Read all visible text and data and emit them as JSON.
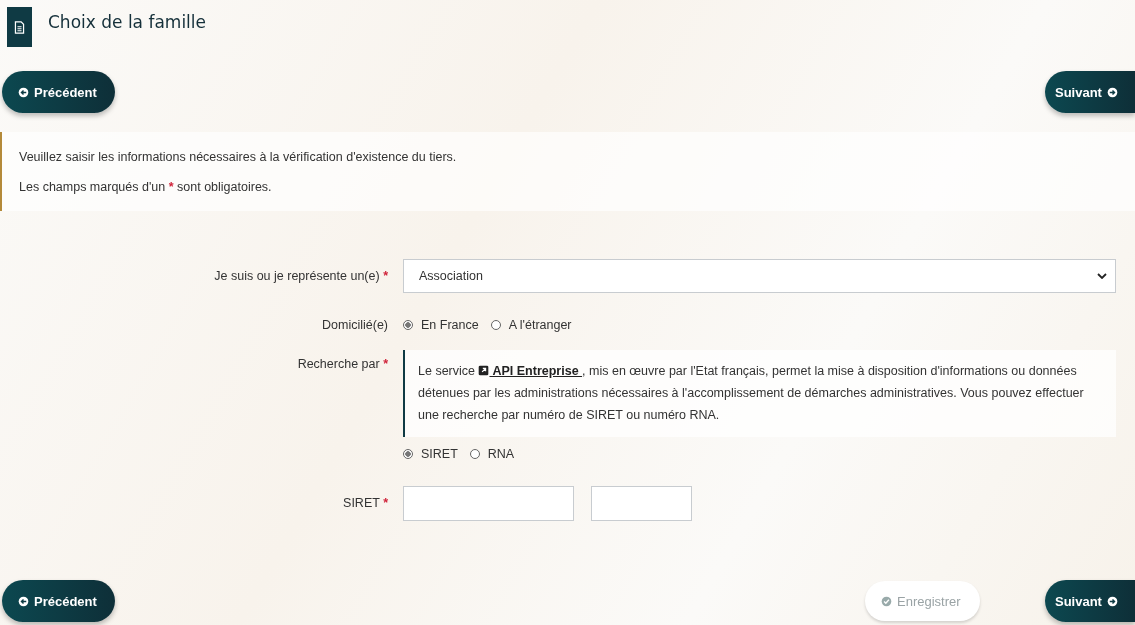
{
  "header": {
    "title": "Choix de la famille"
  },
  "top_nav": [
    {
      "kind": "previous",
      "label": "Précédent"
    },
    {
      "kind": "next",
      "label": "Suivant"
    }
  ],
  "notice": {
    "lines": [
      {
        "before": "Veuillez saisir les informations nécessaires à la vérification d'existence du tiers."
      },
      {
        "before": "Les champs marqués d'un",
        "mark": "*",
        "after": "sont obligatoires."
      }
    ]
  },
  "form": {
    "rows": [
      {
        "kind": "select",
        "label": "Je suis ou je représente un(e)",
        "required": true,
        "value": "Association"
      },
      {
        "kind": "radios",
        "label": "Domicilié(e)",
        "required": false,
        "options": [
          {
            "label": "En France",
            "selected": true
          },
          {
            "label": "A l'étranger",
            "selected": false
          }
        ]
      },
      {
        "kind": "search",
        "label": "Recherche par",
        "required": true,
        "info": {
          "before": "Le service",
          "link": "API Entreprise",
          "after": ", mis en œuvre par l'Etat français, permet la mise à disposition d'informations ou données détenues par les administrations nécessaires à l'accomplissement de démarches administratives. Vous pouvez effectuer une recherche par numéro de SIRET ou numéro RNA."
        },
        "options": [
          {
            "label": "SIRET",
            "selected": true
          },
          {
            "label": "RNA",
            "selected": false
          }
        ]
      },
      {
        "kind": "inputs",
        "label": "SIRET",
        "required": true,
        "inputs": [
          {
            "kind": "wide"
          },
          {
            "kind": "narrow"
          }
        ]
      }
    ]
  },
  "bottom_nav": [
    {
      "kind": "previous",
      "label": "Précédent",
      "disabled": false
    },
    {
      "kind": "save",
      "label": "Enregistrer",
      "disabled": true
    },
    {
      "kind": "next",
      "label": "Suivant",
      "disabled": false
    }
  ]
}
